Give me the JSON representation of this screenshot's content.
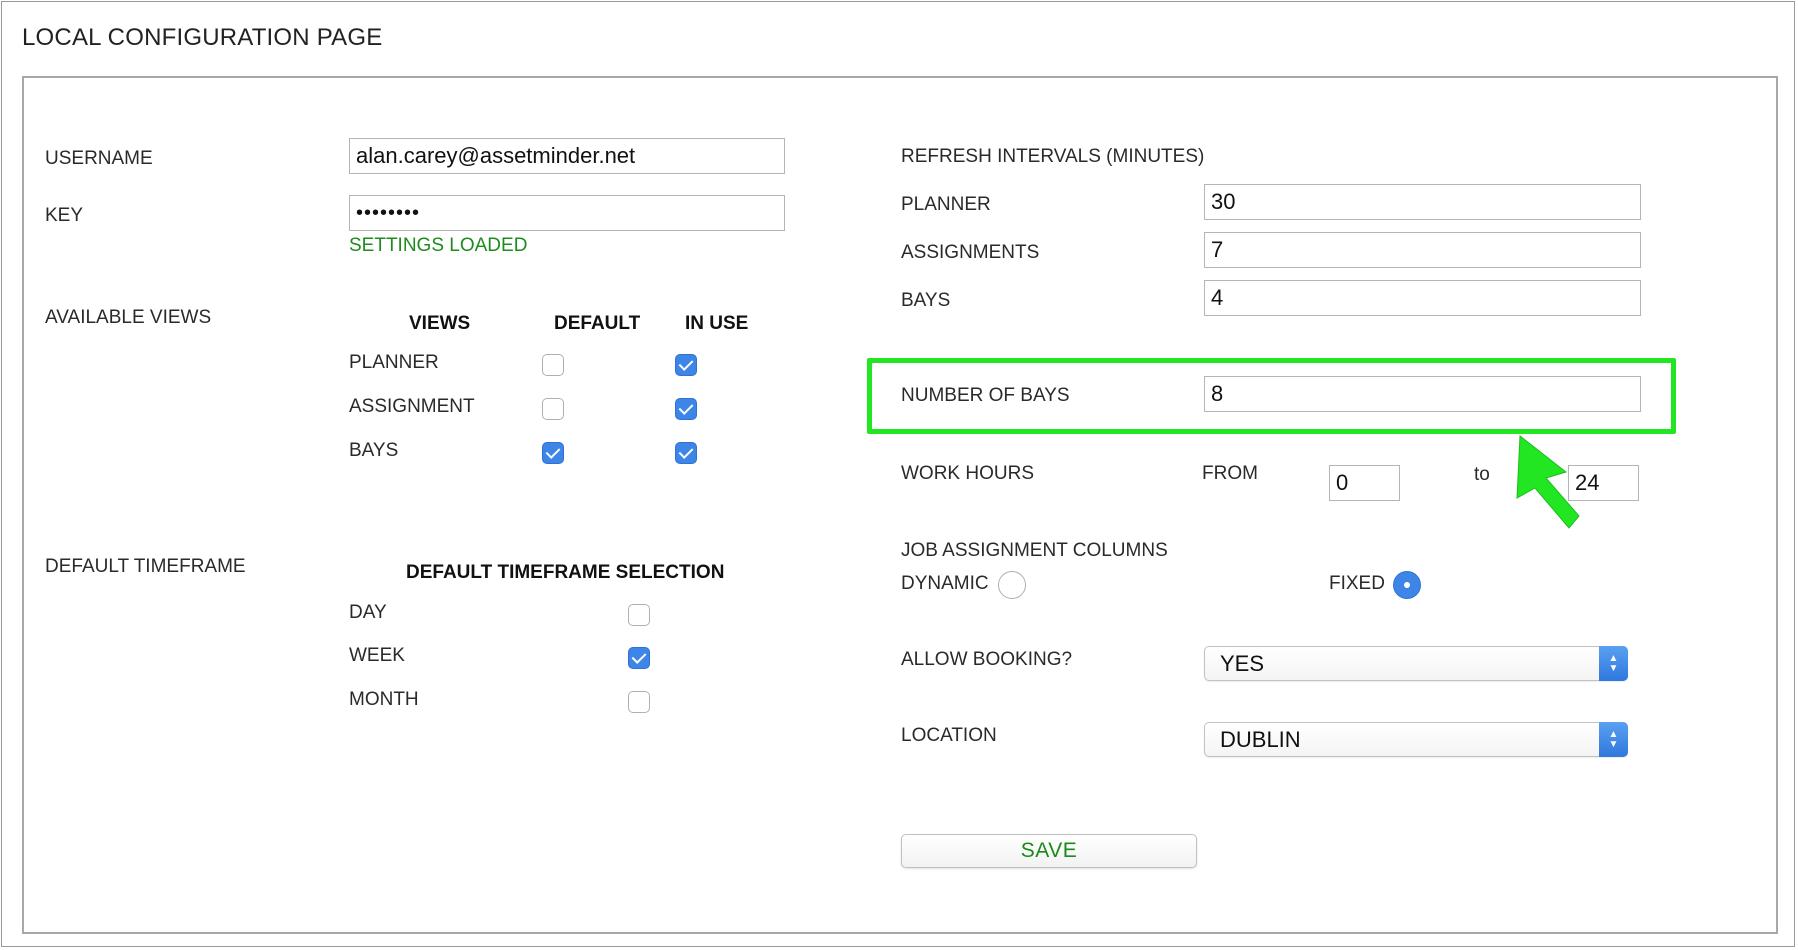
{
  "page": {
    "title": "LOCAL CONFIGURATION PAGE"
  },
  "account": {
    "username_label": "USERNAME",
    "username_value": "alan.carey@assetminder.net",
    "key_label": "KEY",
    "key_value": "••••••••",
    "status": "SETTINGS LOADED"
  },
  "views": {
    "section_label": "AVAILABLE VIEWS",
    "col_views": "VIEWS",
    "col_default": "DEFAULT",
    "col_in_use": "IN USE",
    "rows": [
      {
        "name": "PLANNER",
        "default": false,
        "in_use": true
      },
      {
        "name": "ASSIGNMENT",
        "default": false,
        "in_use": true
      },
      {
        "name": "BAYS",
        "default": true,
        "in_use": true
      }
    ]
  },
  "timeframe": {
    "section_label": "DEFAULT TIMEFRAME",
    "header": "DEFAULT TIMEFRAME SELECTION",
    "options": [
      {
        "name": "DAY",
        "checked": false
      },
      {
        "name": "WEEK",
        "checked": true
      },
      {
        "name": "MONTH",
        "checked": false
      }
    ]
  },
  "refresh": {
    "section_label": "REFRESH INTERVALS (MINUTES)",
    "planner_label": "PLANNER",
    "planner_value": "30",
    "assignments_label": "ASSIGNMENTS",
    "assignments_value": "7",
    "bays_label": "BAYS",
    "bays_value": "4"
  },
  "bays": {
    "label": "NUMBER OF BAYS",
    "value": "8"
  },
  "work_hours": {
    "label": "WORK HOURS",
    "from_label": "FROM",
    "from_value": "0",
    "to_label": "to",
    "to_value": "24"
  },
  "job_columns": {
    "label": "JOB ASSIGNMENT COLUMNS",
    "dynamic_label": "DYNAMIC",
    "fixed_label": "FIXED",
    "selected": "FIXED"
  },
  "booking": {
    "label": "ALLOW BOOKING?",
    "value": "YES"
  },
  "location": {
    "label": "LOCATION",
    "value": "DUBLIN"
  },
  "actions": {
    "save_label": "SAVE"
  },
  "colors": {
    "accent": "#3d86e8",
    "highlight": "#22e622",
    "status_green": "#1f8b1f"
  }
}
